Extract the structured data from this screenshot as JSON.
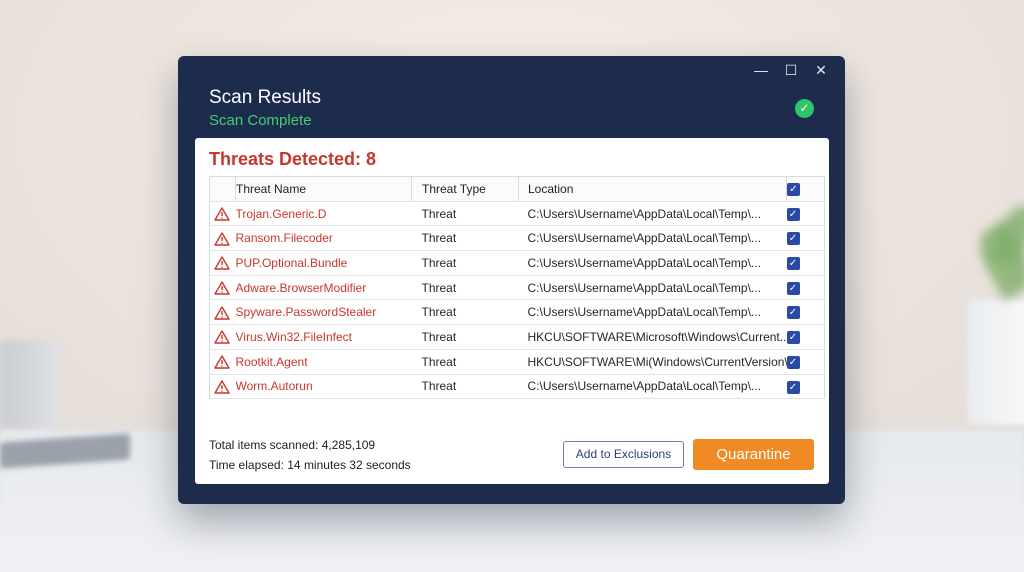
{
  "window": {
    "title": "Scan Results",
    "subtitle": "Scan Complete",
    "controls": {
      "minimize": "—",
      "maximize": "☐",
      "close": "✕"
    },
    "status_icon": "check-circle-icon",
    "colors": {
      "frame": "#1d2b4d",
      "success": "#3ecf75",
      "danger": "#c8372d",
      "accent": "#ef8a24",
      "checkbox": "#2a4aa5"
    }
  },
  "panel": {
    "heading": "Threats Detected: 8",
    "table": {
      "headers": {
        "name": "Threat Name",
        "type": "Threat Type",
        "location": "Location"
      },
      "rows": [
        {
          "name": "Trojan.Generic.D",
          "type": "Threat",
          "location": "C:\\Users\\Username\\AppData\\Local\\Temp\\...",
          "checked": true
        },
        {
          "name": "Ransom.Filecoder",
          "type": "Threat",
          "location": "C:\\Users\\Username\\AppData\\Local\\Temp\\...",
          "checked": true
        },
        {
          "name": "PUP.Optional.Bundle",
          "type": "Threat",
          "location": "C:\\Users\\Username\\AppData\\Local\\Temp\\...",
          "checked": true
        },
        {
          "name": "Adware.BrowserModifier",
          "type": "Threat",
          "location": "C:\\Users\\Username\\AppData\\Local\\Temp\\...",
          "checked": true
        },
        {
          "name": "Spyware.PasswordStealer",
          "type": "Threat",
          "location": "C:\\Users\\Username\\AppData\\Local\\Temp\\...",
          "checked": true
        },
        {
          "name": "Virus.Win32.FileInfect",
          "type": "Threat",
          "location": "HKCU\\SOFTWARE\\Microsoft\\Windows\\Current...",
          "checked": true
        },
        {
          "name": "Rootkit.Agent",
          "type": "Threat",
          "location": "HKCU\\SOFTWARE\\Mi(Windows\\CurrentVersion\\Run...",
          "checked": true
        },
        {
          "name": "Worm.Autorun",
          "type": "Threat",
          "location": "C:\\Users\\Username\\AppData\\Local\\Temp\\...",
          "checked": true
        }
      ]
    },
    "footer": {
      "total_scanned": "Total items scanned: 4,285,109",
      "time_elapsed": "Time elapsed: 14 minutes 32 seconds"
    },
    "buttons": {
      "exclusions": "Add to Exclusions",
      "quarantine": "Quarantine"
    }
  }
}
